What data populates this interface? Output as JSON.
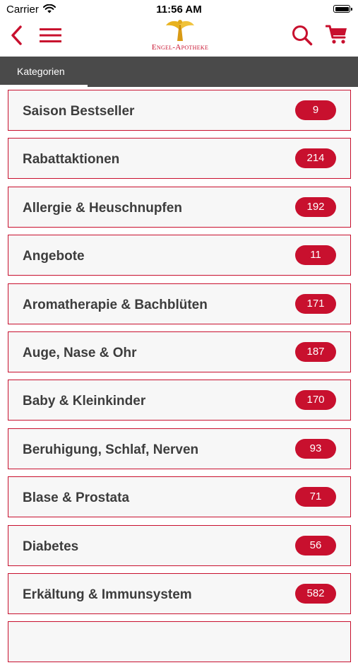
{
  "status": {
    "carrier": "Carrier",
    "time": "11:56 AM"
  },
  "header": {
    "logo_text": "Engel-Apotheke",
    "icons": [
      "back-icon",
      "menu-icon",
      "search-icon",
      "cart-icon"
    ],
    "accent_color": "#c8102e"
  },
  "tabs": {
    "active": "Kategorien"
  },
  "categories": [
    {
      "label": "Saison Bestseller",
      "count": "9"
    },
    {
      "label": "Rabattaktionen",
      "count": "214"
    },
    {
      "label": "Allergie & Heuschnupfen",
      "count": "192"
    },
    {
      "label": "Angebote",
      "count": "11"
    },
    {
      "label": "Aromatherapie & Bachblüten",
      "count": "171"
    },
    {
      "label": "Auge, Nase & Ohr",
      "count": "187"
    },
    {
      "label": "Baby & Kleinkinder",
      "count": "170"
    },
    {
      "label": "Beruhigung, Schlaf, Nerven",
      "count": "93"
    },
    {
      "label": "Blase & Prostata",
      "count": "71"
    },
    {
      "label": "Diabetes",
      "count": "56"
    },
    {
      "label": "Erkältung & Immunsystem",
      "count": "582"
    }
  ]
}
